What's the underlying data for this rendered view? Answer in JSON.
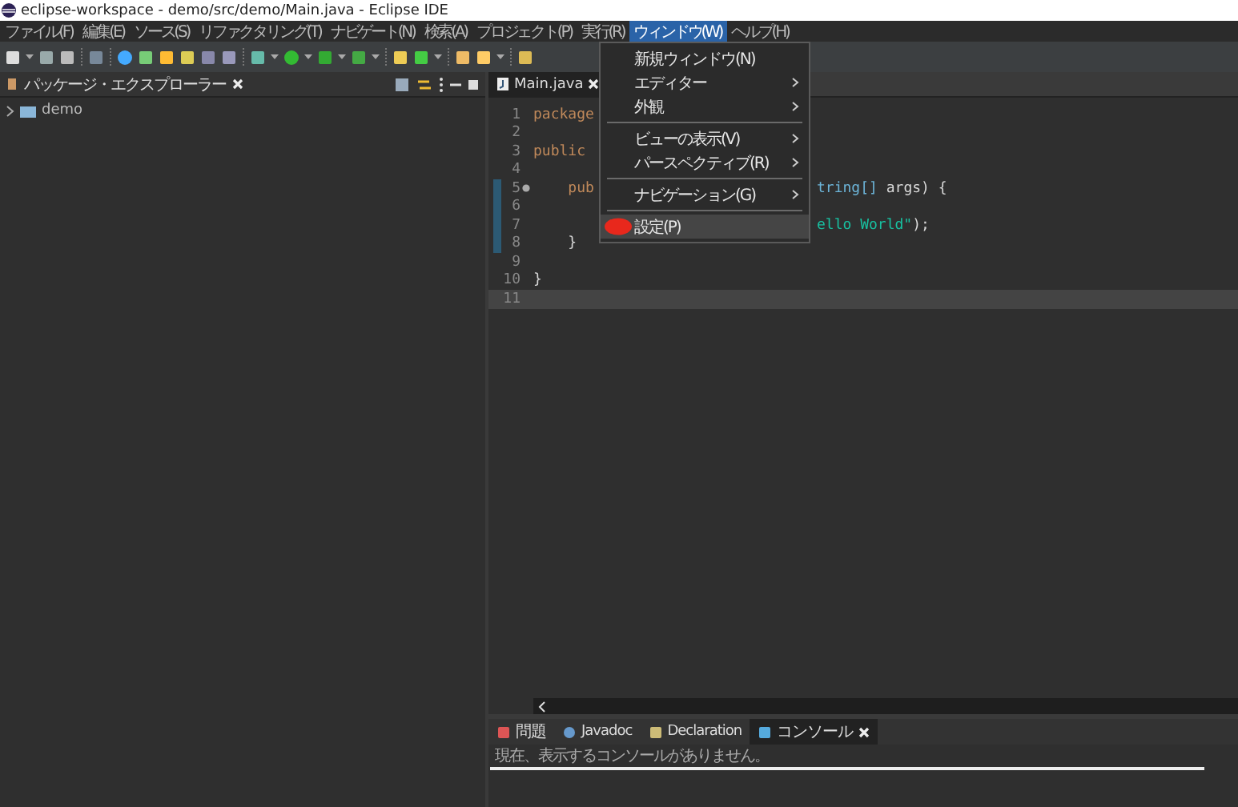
{
  "window": {
    "title": "eclipse-workspace - demo/src/demo/Main.java - Eclipse IDE"
  },
  "menubar": [
    {
      "label": "ファイル(F)",
      "selected": false
    },
    {
      "label": "編集(E)",
      "selected": false
    },
    {
      "label": "ソース(S)",
      "selected": false
    },
    {
      "label": "リファクタリング(T)",
      "selected": false
    },
    {
      "label": "ナビゲート(N)",
      "selected": false
    },
    {
      "label": "検索(A)",
      "selected": false
    },
    {
      "label": "プロジェクト(P)",
      "selected": false
    },
    {
      "label": "実行(R)",
      "selected": false
    },
    {
      "label": "ウィンドウ(W)",
      "selected": true
    },
    {
      "label": "ヘルプ(H)",
      "selected": false
    }
  ],
  "window_menu": {
    "groups": [
      [
        {
          "label": "新規ウィンドウ(N)",
          "submenu": false,
          "selected": false,
          "marked": false
        },
        {
          "label": "エディター",
          "submenu": true,
          "selected": false,
          "marked": false
        },
        {
          "label": "外観",
          "submenu": true,
          "selected": false,
          "marked": false
        }
      ],
      [
        {
          "label": "ビューの表示(V)",
          "submenu": true,
          "selected": false,
          "marked": false
        },
        {
          "label": "パースペクティブ(R)",
          "submenu": true,
          "selected": false,
          "marked": false
        }
      ],
      [
        {
          "label": "ナビゲーション(G)",
          "submenu": true,
          "selected": false,
          "marked": false
        }
      ],
      [
        {
          "label": "設定(P)",
          "submenu": false,
          "selected": true,
          "marked": true
        }
      ]
    ]
  },
  "package_explorer": {
    "title": "パッケージ・エクスプローラー",
    "tree": [
      {
        "label": "demo",
        "expanded": false
      }
    ]
  },
  "editor": {
    "tabs": [
      {
        "label": "Main.java",
        "selected": true
      }
    ],
    "lines": [
      {
        "number": "1",
        "left": [
          {
            "text": "package",
            "kind": "keyword"
          }
        ],
        "changed": false,
        "override": false,
        "current": false
      },
      {
        "number": "2",
        "changed": false,
        "override": false,
        "current": false
      },
      {
        "number": "3",
        "left": [
          {
            "text": "public",
            "kind": "keyword"
          }
        ],
        "changed": false,
        "override": false,
        "current": false
      },
      {
        "number": "4",
        "changed": false,
        "override": false,
        "current": false
      },
      {
        "number": "5",
        "left": [
          {
            "text": "    pub",
            "kind": "keyword"
          }
        ],
        "right": [
          {
            "text": "tring[]",
            "kind": "type"
          },
          {
            "text": " args) {",
            "kind": "plain"
          }
        ],
        "changed": true,
        "override": true,
        "current": false
      },
      {
        "number": "6",
        "changed": true,
        "override": false,
        "current": false
      },
      {
        "number": "7",
        "right": [
          {
            "text": "ello World\"",
            "kind": "string"
          },
          {
            "text": ");",
            "kind": "plain"
          }
        ],
        "changed": true,
        "override": false,
        "current": false
      },
      {
        "number": "8",
        "left": [
          {
            "text": "    }",
            "kind": "plain"
          }
        ],
        "changed": true,
        "override": false,
        "current": false
      },
      {
        "number": "9",
        "changed": false,
        "override": false,
        "current": false
      },
      {
        "number": "10",
        "left": [
          {
            "text": "}",
            "kind": "plain"
          }
        ],
        "changed": false,
        "override": false,
        "current": false
      },
      {
        "number": "11",
        "changed": false,
        "override": false,
        "current": true
      }
    ]
  },
  "bottom_panel": {
    "tabs": [
      {
        "label": "問題",
        "selected": false
      },
      {
        "label": "Javadoc",
        "selected": false
      },
      {
        "label": "Declaration",
        "selected": false
      },
      {
        "label": "コンソール",
        "selected": true
      }
    ],
    "message": "現在、表示するコンソールがありません。"
  }
}
